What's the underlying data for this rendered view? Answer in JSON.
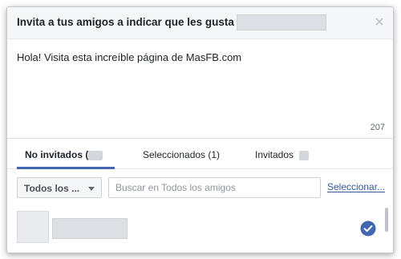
{
  "dialog": {
    "title": "Invita a tus amigos a indicar que les gusta",
    "close_icon": "close-icon"
  },
  "message": {
    "text": "Hola! Visita esta increíble página de MasFB.com",
    "char_count": "207"
  },
  "tabs": [
    {
      "label": "No invitados (",
      "active": true
    },
    {
      "label": "Seleccionados (1)",
      "active": false
    },
    {
      "label": "Invitados",
      "active": false
    }
  ],
  "toolbar": {
    "filter_label": "Todos los ...",
    "search_placeholder": "Buscar en Todos los amigos",
    "select_link": "Seleccionar..."
  },
  "friend": {
    "selected": true,
    "check_icon": "checkmark-circle-icon",
    "check_color": "#4267b2"
  },
  "colors": {
    "accent": "#4267b2",
    "link": "#365899",
    "header_bg": "#f5f6f7"
  }
}
